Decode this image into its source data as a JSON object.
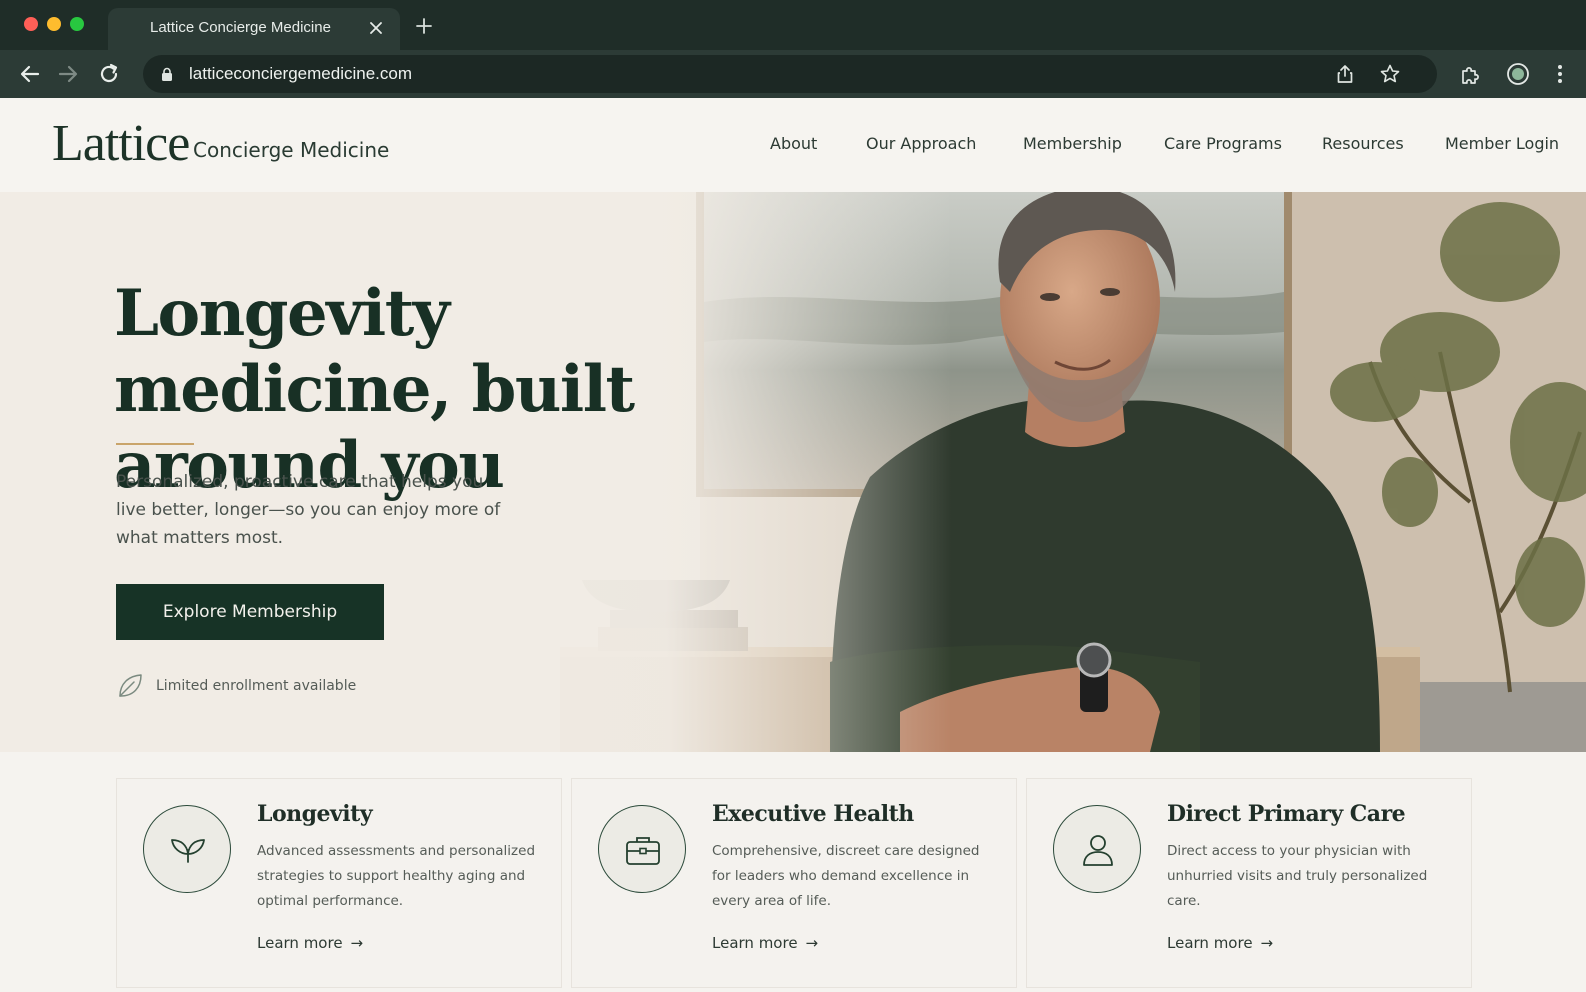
{
  "browser": {
    "tab_title": "Lattice Concierge Medicine",
    "url": "latticeconciergemedicine.com"
  },
  "site": {
    "logo": {
      "name": "Lattice",
      "tagline": "Concierge Medicine"
    },
    "nav": [
      "About",
      "Our Approach",
      "Membership",
      "Care Programs",
      "Resources",
      "Member Login"
    ],
    "hero": {
      "title": "Longevity medicine, built around you",
      "description": "Personalized, proactive care that helps you live better, longer—so you can enjoy more of what matters most.",
      "cta": "Explore Membership",
      "enrollment_note": "Limited enrollment available"
    },
    "cards": [
      {
        "title": "Longevity",
        "description": "Advanced assessments and personalized strategies to support healthy aging and optimal performance.",
        "link": "Learn more",
        "icon": "sprout-icon"
      },
      {
        "title": "Executive Health",
        "description": "Comprehensive, discreet care designed for leaders who demand excellence in every area of life.",
        "link": "Learn more",
        "icon": "briefcase-icon"
      },
      {
        "title": "Direct Primary Care",
        "description": "Direct access to your physician with unhurried visits and truly personalized care.",
        "link": "Learn more",
        "icon": "user-icon"
      }
    ],
    "colors": {
      "brand_green": "#173326",
      "accent_gold": "#c9a46a",
      "background": "#f5f3ef"
    }
  }
}
